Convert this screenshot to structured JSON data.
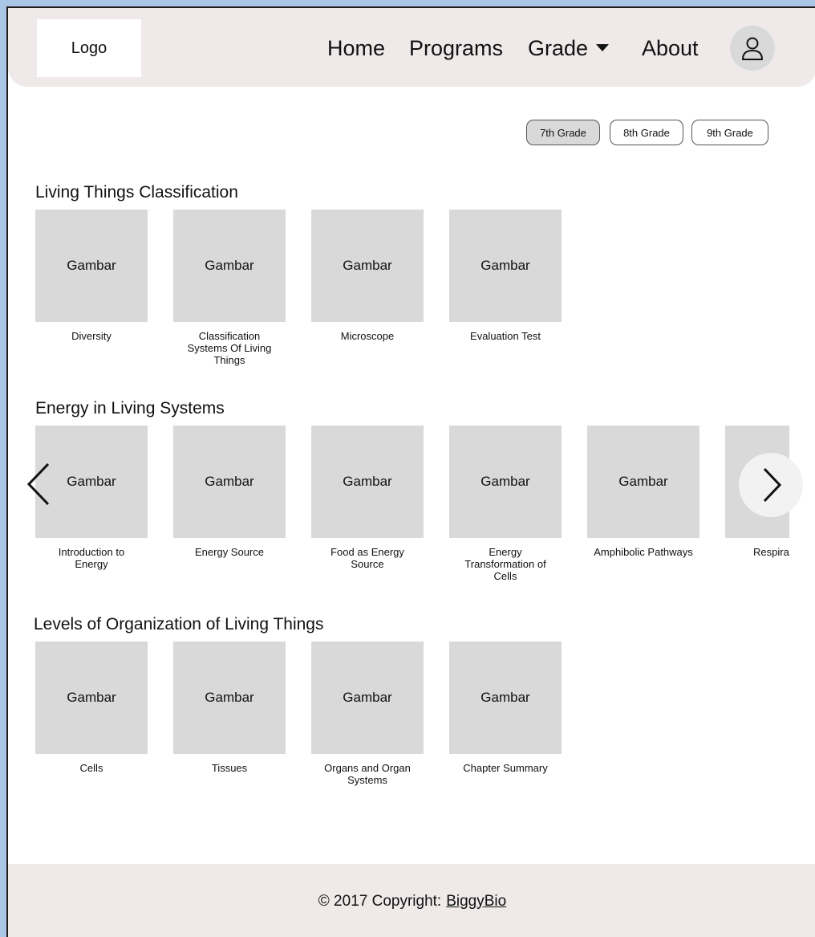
{
  "header": {
    "logo": "Logo",
    "nav": {
      "home": "Home",
      "programs": "Programs",
      "grade": "Grade",
      "about": "About"
    },
    "profile_icon": "user-icon"
  },
  "grades": [
    "7th Grade",
    "8th Grade",
    "9th Grade"
  ],
  "selected_grade": "7th Grade",
  "sections": [
    {
      "title": "Living Things Classification",
      "cards": [
        {
          "image": "Gambar",
          "label": "Diversity"
        },
        {
          "image": "Gambar",
          "label": "Classification Systems Of Living Things"
        },
        {
          "image": "Gambar",
          "label": "Microscope"
        },
        {
          "image": "Gambar",
          "label": "Evaluation Test"
        }
      ]
    },
    {
      "title": "Energy in Living Systems",
      "cards": [
        {
          "image": "Gambar",
          "label": "Introduction to Energy"
        },
        {
          "image": "Gambar",
          "label": "Energy Source"
        },
        {
          "image": "Gambar",
          "label": "Food as Energy Source"
        },
        {
          "image": "Gambar",
          "label": "Energy Transformation of Cells"
        },
        {
          "image": "Gambar",
          "label": "Amphibolic Pathways"
        },
        {
          "image": "Gambar",
          "label": "Respira"
        }
      ]
    },
    {
      "title": "Levels of Organization of Living Things",
      "cards": [
        {
          "image": "Gambar",
          "label": "Cells"
        },
        {
          "image": "Gambar",
          "label": "Tissues"
        },
        {
          "image": "Gambar",
          "label": "Organs and Organ Systems"
        },
        {
          "image": "Gambar",
          "label": "Chapter Summary"
        }
      ]
    }
  ],
  "carousel_icons": {
    "prev": "chevron-left-icon",
    "next": "chevron-right-icon"
  },
  "footer": {
    "copyright": "© 2017 Copyright:",
    "brand": "BiggyBio"
  },
  "colors": {
    "header_bg": "#efe9e9",
    "placeholder": "#d9d9d9",
    "active_pill": "#d9d9d9",
    "outer_bg": "#a9c6e4"
  }
}
